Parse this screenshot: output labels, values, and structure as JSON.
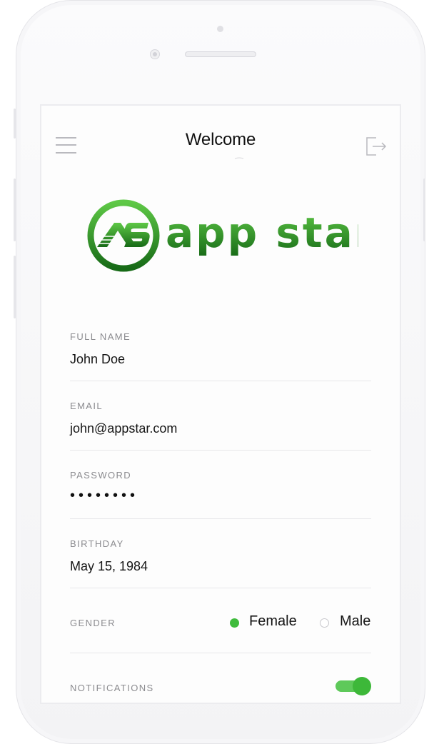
{
  "header": {
    "title": "Welcome",
    "menu_icon": "hamburger-menu-icon",
    "logout_icon": "logout-icon"
  },
  "logo": {
    "monogram": "AS",
    "wordmark": "APP STAR.",
    "colors": {
      "green_light": "#5ec846",
      "green_dark": "#176a17"
    }
  },
  "form": {
    "full_name": {
      "label": "FULL NAME",
      "value": "John Doe"
    },
    "email": {
      "label": "EMAIL",
      "value": "john@appstar.com"
    },
    "password": {
      "label": "PASSWORD",
      "value": "••••••••"
    },
    "birthday": {
      "label": "BIRTHDAY",
      "value": "May 15, 1984"
    },
    "gender": {
      "label": "GENDER",
      "options": [
        {
          "label": "Female",
          "selected": true
        },
        {
          "label": "Male",
          "selected": false
        }
      ]
    },
    "notifications": {
      "label": "NOTIFICATIONS",
      "enabled": true
    }
  },
  "colors": {
    "accent": "#3fbb3c",
    "text": "#151515",
    "label": "#8b8b8f",
    "divider": "#e7e7ea"
  }
}
